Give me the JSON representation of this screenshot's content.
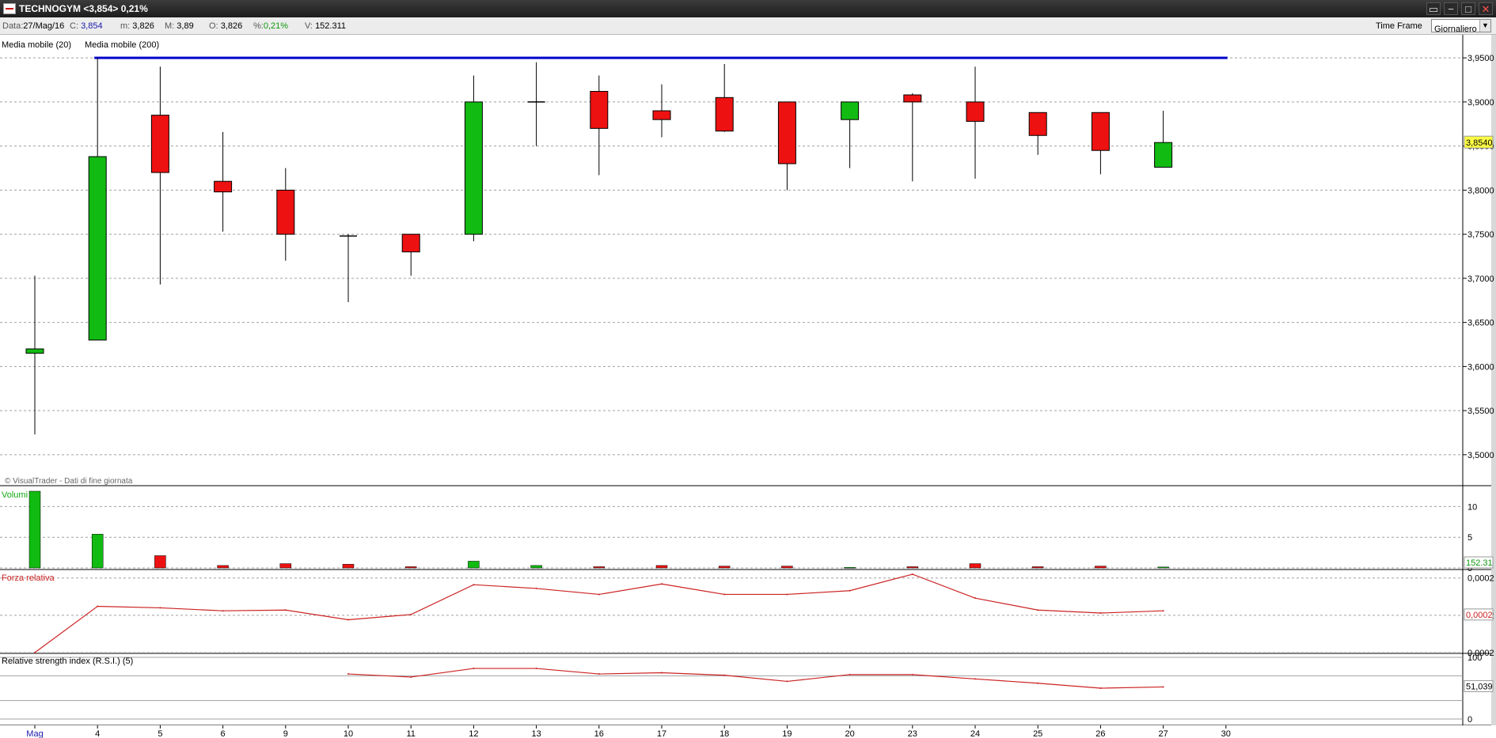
{
  "window": {
    "title": "TECHNOGYM <3,854> 0,21%",
    "controls": [
      "▭",
      "−",
      "□",
      "✕"
    ]
  },
  "infobar": {
    "data_label": "Data:",
    "data_value": "27/Mag/16",
    "close_label": "C:",
    "close_value": "3,854",
    "min_label": "m:",
    "min_value": "3,826",
    "max_label": "M:",
    "max_value": "3,89",
    "open_label": "O:",
    "open_value": "3,826",
    "pct_label": "%:",
    "pct_value": "0,21%",
    "vol_label": "V:",
    "vol_value": "152.311",
    "timeframe_label": "Time Frame",
    "timeframe_value": "Giornaliero"
  },
  "indicators": {
    "ma20": "Media mobile (20)",
    "ma200": "Media mobile (200)"
  },
  "watermark": "© VisualTrader - Dati di fine giornata",
  "colors": {
    "up": "#11bb11",
    "down": "#ee1111",
    "ma200": "#0000cc",
    "line": "#cc2222",
    "grid": "#a0a0a0"
  },
  "chart_data": [
    {
      "type": "candlestick",
      "x": [
        "Mag",
        "4",
        "5",
        "6",
        "9",
        "10",
        "11",
        "12",
        "13",
        "16",
        "17",
        "18",
        "19",
        "20",
        "23",
        "24",
        "25",
        "26",
        "27"
      ],
      "x_axis_extra": [
        "30"
      ],
      "open": [
        3.615,
        3.63,
        3.885,
        3.81,
        3.8,
        3.748,
        3.75,
        3.75,
        3.9,
        3.912,
        3.89,
        3.905,
        3.9,
        3.88,
        3.908,
        3.9,
        3.888,
        3.888,
        3.826
      ],
      "high": [
        3.703,
        3.95,
        3.94,
        3.866,
        3.825,
        3.75,
        3.75,
        3.93,
        3.945,
        3.93,
        3.92,
        3.943,
        3.9,
        3.9,
        3.91,
        3.94,
        3.888,
        3.888,
        3.89
      ],
      "low": [
        3.523,
        3.63,
        3.693,
        3.753,
        3.72,
        3.673,
        3.703,
        3.742,
        3.85,
        3.817,
        3.86,
        3.866,
        3.8,
        3.825,
        3.81,
        3.813,
        3.84,
        3.818,
        3.826
      ],
      "close": [
        3.62,
        3.838,
        3.82,
        3.798,
        3.75,
        3.748,
        3.73,
        3.9,
        3.9,
        3.87,
        3.88,
        3.867,
        3.83,
        3.9,
        3.9,
        3.878,
        3.862,
        3.845,
        3.854
      ],
      "ylim": [
        3.49,
        3.96
      ],
      "yticks": [
        "3,5000",
        "3,5500",
        "3,6000",
        "3,6500",
        "3,7000",
        "3,7500",
        "3,8000",
        "3,8500",
        "3,9000",
        "3,9500"
      ],
      "last_price_label": "3,8540",
      "ma200_value": 3.95,
      "grid": true
    },
    {
      "type": "bar",
      "title": "Volumi",
      "x": [
        "Mag",
        "4",
        "5",
        "6",
        "9",
        "10",
        "11",
        "12",
        "13",
        "16",
        "17",
        "18",
        "19",
        "20",
        "23",
        "24",
        "25",
        "26",
        "27"
      ],
      "values": [
        12.5,
        5.5,
        2.0,
        0.4,
        0.7,
        0.6,
        0.2,
        1.1,
        0.4,
        0.2,
        0.4,
        0.3,
        0.3,
        0.1,
        0.2,
        0.7,
        0.2,
        0.3,
        0.15
      ],
      "direction": [
        "up",
        "up",
        "down",
        "down",
        "down",
        "down",
        "down",
        "up",
        "up",
        "down",
        "down",
        "down",
        "down",
        "up",
        "down",
        "down",
        "down",
        "down",
        "up"
      ],
      "ylim": [
        0,
        12.5
      ],
      "yticks": [
        "0",
        "5",
        "10"
      ],
      "last_label": "152.31"
    },
    {
      "type": "line",
      "title": "Forza relativa",
      "x": [
        "Mag",
        "4",
        "5",
        "6",
        "9",
        "10",
        "11",
        "12",
        "13",
        "16",
        "17",
        "18",
        "19",
        "20",
        "23",
        "24",
        "25",
        "26",
        "27"
      ],
      "values": [
        0.0,
        0.62,
        0.6,
        0.56,
        0.57,
        0.44,
        0.51,
        0.91,
        0.86,
        0.78,
        0.92,
        0.78,
        0.78,
        0.83,
        1.05,
        0.73,
        0.57,
        0.53,
        0.56
      ],
      "ylim": [
        0,
        1.05
      ],
      "yticks": [
        "0,0002",
        "0,0002",
        "0,0002"
      ],
      "last_label": "0,0002"
    },
    {
      "type": "line",
      "title": "Relative strength index (R.S.I.) (5)",
      "x": [
        "10",
        "11",
        "12",
        "13",
        "16",
        "17",
        "18",
        "19",
        "20",
        "23",
        "24",
        "25",
        "26",
        "27"
      ],
      "values": [
        73,
        68,
        82,
        82,
        73,
        75,
        71,
        61,
        72,
        72,
        65,
        58,
        50,
        52
      ],
      "ylim": [
        0,
        100
      ],
      "yticks": [
        "0",
        "100"
      ],
      "last_label": "51,039"
    }
  ]
}
